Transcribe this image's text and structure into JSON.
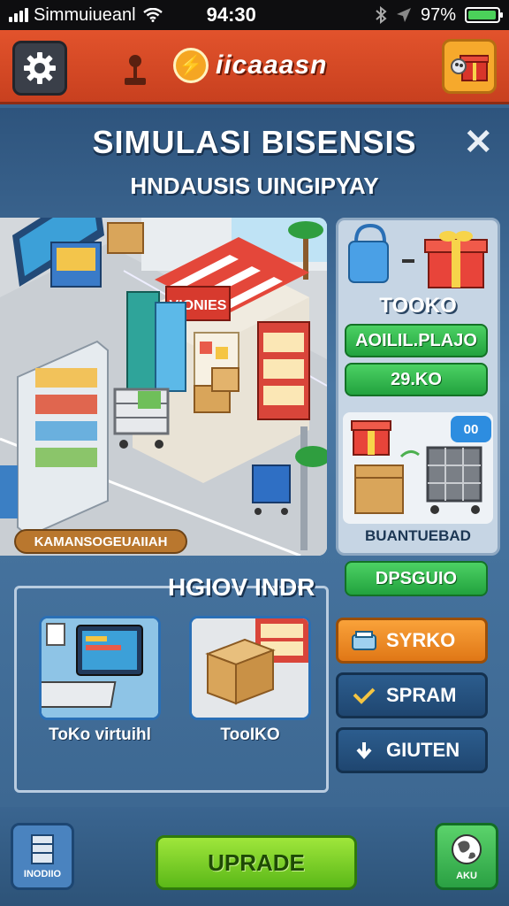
{
  "status_bar": {
    "carrier": "Simmuiueanl",
    "time": "94:30",
    "battery": "97%"
  },
  "header": {
    "logo_text": "iicaaasn"
  },
  "dialog": {
    "title": "SIMULASI BISENSIS",
    "subtitle": "HNDAUSIS UINGIPYAY",
    "close_symbol": "✕"
  },
  "scene": {
    "shop_sign": "VIONIES",
    "caption": "KAMANSOGEUAIIAH"
  },
  "side_panel": {
    "label": "TOOKO",
    "pill_1": "AOILIL.PLAJO",
    "pill_2": "29.KO",
    "chat_badge": "00",
    "caption": "BUANTUEBAD",
    "pill_3": "DPSGUIO"
  },
  "section": {
    "title": "HGIOV INDR",
    "items": [
      {
        "label": "ToKo virtuihl"
      },
      {
        "label": "TooIKO"
      }
    ]
  },
  "actions": {
    "btn_1": "SYRKO",
    "btn_2": "SPRAM",
    "btn_3": "GIUTEN"
  },
  "footer": {
    "left_label": "INODIIO",
    "upgrade_label": "UPRADE",
    "right_label": "AKU"
  },
  "colors": {
    "header": "#d9492a",
    "panel": "#3a6590",
    "green": "#2fb34a",
    "orange": "#f08b25"
  },
  "icons": {
    "settings": "gear-icon",
    "gift": "gift-icon",
    "joystick": "joystick-icon",
    "close": "close-icon"
  }
}
